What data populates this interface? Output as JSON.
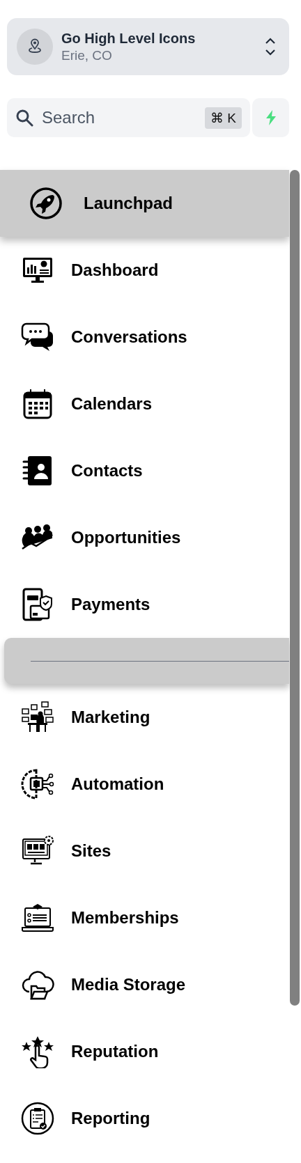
{
  "location": {
    "name": "Go High Level Icons",
    "place": "Erie, CO"
  },
  "search": {
    "placeholder": "Search",
    "shortcut": "⌘ K"
  },
  "nav": [
    {
      "kind": "item",
      "label": "Launchpad",
      "selected": true
    },
    {
      "kind": "item",
      "label": "Dashboard",
      "selected": false
    },
    {
      "kind": "item",
      "label": "Conversations",
      "selected": false
    },
    {
      "kind": "item",
      "label": "Calendars",
      "selected": false
    },
    {
      "kind": "item",
      "label": "Contacts",
      "selected": false
    },
    {
      "kind": "item",
      "label": "Opportunities",
      "selected": false
    },
    {
      "kind": "item",
      "label": "Payments",
      "selected": false
    },
    {
      "kind": "divider"
    },
    {
      "kind": "item",
      "label": "Marketing",
      "selected": false
    },
    {
      "kind": "item",
      "label": "Automation",
      "selected": false
    },
    {
      "kind": "item",
      "label": "Sites",
      "selected": false
    },
    {
      "kind": "item",
      "label": "Memberships",
      "selected": false
    },
    {
      "kind": "item",
      "label": "Media Storage",
      "selected": false
    },
    {
      "kind": "item",
      "label": "Reputation",
      "selected": false
    },
    {
      "kind": "item",
      "label": "Reporting",
      "selected": false
    }
  ]
}
